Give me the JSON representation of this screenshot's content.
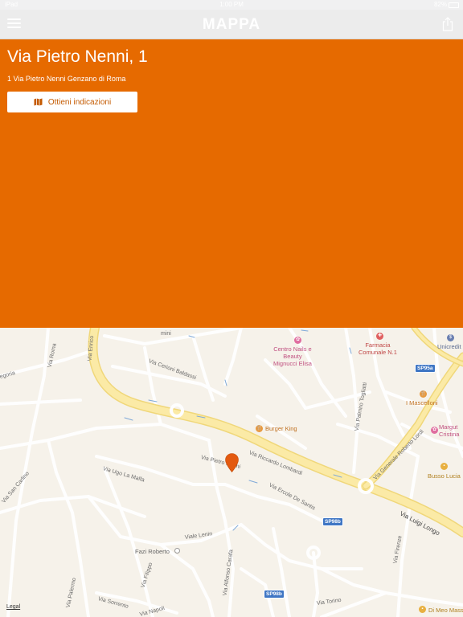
{
  "status_bar": {
    "carrier": "iPad",
    "time": "1:00 PM",
    "battery": "82%"
  },
  "nav": {
    "title": "MAPPA"
  },
  "place": {
    "title": "Via Pietro Nenni, 1",
    "address": "1 Via Pietro Nenni Genzano di Roma",
    "directions_label": "Ottieni indicazioni"
  },
  "map": {
    "legal": "Legal",
    "streets": {
      "via_enrico": "Via Enrico",
      "via_roma": "Via Roma",
      "gregoria": "egoria",
      "via_cerioni": "Via Cerioni Baldassi",
      "via_riccardo": "Via Riccardo Lombardi",
      "via_pietro_nenni": "Via Pietro Nenni",
      "via_ugo": "Via Ugo La Malfa",
      "via_san_carlino": "Via San Carlino",
      "via_ercole": "Via Ercole De Santis",
      "viale_lenin": "Viale Lenin",
      "via_filippo": "Via Filippo",
      "via_palermo": "Via Palermo",
      "via_sorrento": "Via Sorrento",
      "via_napoli": "Via Napoli",
      "via_alfonso": "Via Alfonso Carafa",
      "via_torino": "Via Torino",
      "via_firenze": "Via Firenze",
      "via_luigi_longo": "Via Luigi Longo",
      "via_generale": "Via Generale Roberto Lordi",
      "via_palmiro": "Via Palmiro Togliatti",
      "via_gramsci": "mini"
    },
    "pois": {
      "centro_nails": "Centro Nails e\nBeauty\nMignucci Elisa",
      "farmacia": "Farmacia\nComunale N.1",
      "unicredit": "Unicredit",
      "mascelloni": "I Mascelloni",
      "margherita": "Margut\nCristina",
      "burger_king": "Burger King",
      "busso": "Busso Lucia",
      "fazi": "Fazi Roberto",
      "di_meo": "Di Meo Mass"
    },
    "shields": {
      "sp95a": "SP95a",
      "sp98b_1": "SP98b",
      "sp98b_2": "SP98b"
    }
  }
}
